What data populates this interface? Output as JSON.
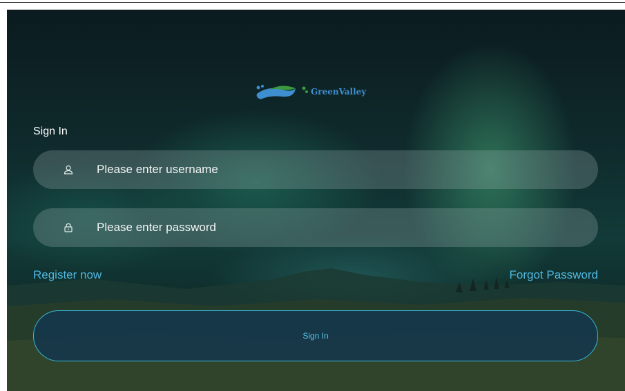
{
  "app": {
    "brand_name": "GreenValley"
  },
  "login": {
    "heading": "Sign In",
    "username": {
      "placeholder": "Please enter username",
      "value": "",
      "icon": "user-icon"
    },
    "password": {
      "placeholder": "Please enter password",
      "value": "",
      "icon": "lock-icon"
    },
    "register_link": "Register now",
    "forgot_link": "Forgot Password",
    "submit_label": "Sign In"
  },
  "colors": {
    "accent": "#4fb8e0",
    "button_border": "#37b9d8",
    "brand_blue": "#3e8fd0",
    "brand_green": "#3a9a3f"
  }
}
